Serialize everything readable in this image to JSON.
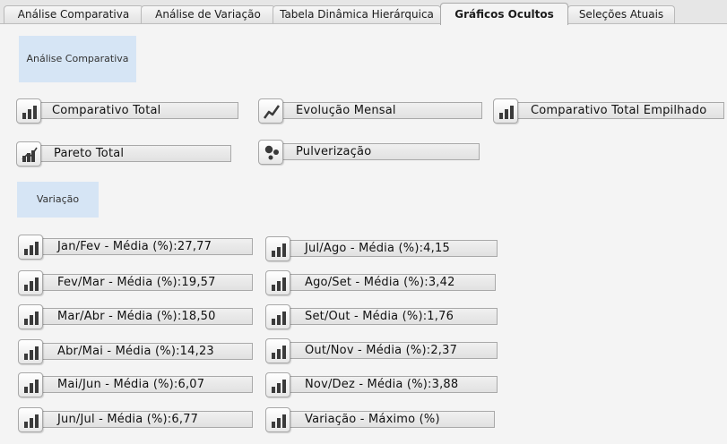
{
  "tabs": [
    {
      "label": "Análise Comparativa"
    },
    {
      "label": "Análise de Variação"
    },
    {
      "label": "Tabela Dinâmica Hierárquica"
    },
    {
      "label": "Gráficos Ocultos"
    },
    {
      "label": "Seleções Atuais"
    }
  ],
  "active_tab": "Gráficos Ocultos",
  "sections": {
    "comparativa": "Análise Comparativa",
    "variacao": "Variação"
  },
  "charts": {
    "comparativo_total": {
      "label": "Comparativo Total",
      "icon": "bar-chart-icon"
    },
    "evolucao_mensal": {
      "label": "Evolução Mensal",
      "icon": "line-chart-icon"
    },
    "comparativo_empilhado": {
      "label": "Comparativo  Total Empilhado",
      "icon": "bar-chart-icon"
    },
    "pareto_total": {
      "label": "Pareto Total",
      "icon": "pareto-chart-icon"
    },
    "pulverizacao": {
      "label": "Pulverização",
      "icon": "scatter-chart-icon"
    }
  },
  "variation_charts": [
    {
      "label": "Jan/Fev - Média (%):27,77"
    },
    {
      "label": "Fev/Mar - Média (%):19,57"
    },
    {
      "label": "Mar/Abr - Média (%):18,50"
    },
    {
      "label": "Abr/Mai - Média (%):14,23"
    },
    {
      "label": "Mai/Jun - Média (%):6,07"
    },
    {
      "label": "Jun/Jul - Média (%):6,77"
    },
    {
      "label": "Jul/Ago - Média (%):4,15"
    },
    {
      "label": "Ago/Set - Média (%):3,42"
    },
    {
      "label": "Set/Out - Média (%):1,76"
    },
    {
      "label": "Out/Nov - Média (%):2,37"
    },
    {
      "label": "Nov/Dez - Média (%):3,88"
    },
    {
      "label": "Variação - Máximo (%)"
    }
  ],
  "colors": {
    "section_bg": "#d6e5f5",
    "icon_dark": "#3a3a3a"
  }
}
